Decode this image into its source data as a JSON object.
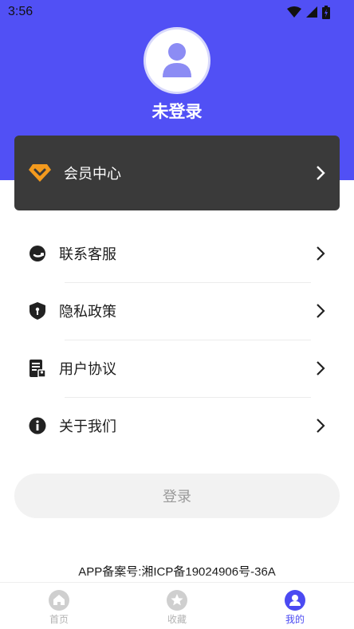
{
  "status_bar": {
    "time": "3:56"
  },
  "profile": {
    "username": "未登录"
  },
  "vip": {
    "label": "会员中心"
  },
  "menu": [
    {
      "label": "联系客服",
      "icon": "customer-service-icon"
    },
    {
      "label": "隐私政策",
      "icon": "shield-icon"
    },
    {
      "label": "用户协议",
      "icon": "agreement-document-icon"
    },
    {
      "label": "关于我们",
      "icon": "info-icon"
    }
  ],
  "login": {
    "label": "登录"
  },
  "footer": {
    "icp": "APP备案号:湘ICP备19024906号-36A"
  },
  "nav": [
    {
      "label": "首页",
      "icon": "home-icon"
    },
    {
      "label": "收藏",
      "icon": "star-icon"
    },
    {
      "label": "我的",
      "icon": "user-icon",
      "active": true
    }
  ],
  "colors": {
    "primary": "#5150f5",
    "vip_card": "#3a3a3a",
    "vip_icon": "#f39a1e",
    "nav_active": "#4b4af2",
    "nav_inactive": "#b3b3b3"
  }
}
